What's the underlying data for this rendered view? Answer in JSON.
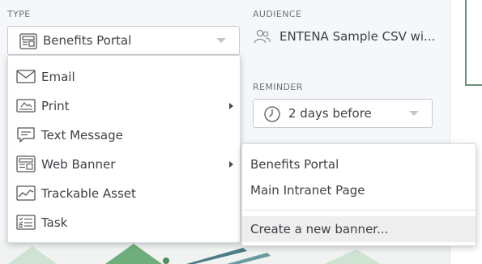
{
  "type_section": {
    "label": "TYPE",
    "selected": "Benefits Portal",
    "selected_icon": "web-banner-icon"
  },
  "audience_section": {
    "label": "AUDIENCE",
    "value": "ENTENA Sample CSV wi...",
    "icon": "people-icon"
  },
  "reminder_section": {
    "label": "REMINDER",
    "selected": "2 days before",
    "icon": "clock-icon"
  },
  "type_menu": {
    "items": [
      {
        "label": "Email",
        "icon": "email-icon",
        "has_submenu": false
      },
      {
        "label": "Print",
        "icon": "print-icon",
        "has_submenu": true
      },
      {
        "label": "Text Message",
        "icon": "text-message-icon",
        "has_submenu": false
      },
      {
        "label": "Web Banner",
        "icon": "web-banner-icon",
        "has_submenu": true
      },
      {
        "label": "Trackable Asset",
        "icon": "trackable-asset-icon",
        "has_submenu": false
      },
      {
        "label": "Task",
        "icon": "task-icon",
        "has_submenu": false
      }
    ]
  },
  "web_banner_submenu": {
    "items": [
      {
        "label": "Benefits Portal"
      },
      {
        "label": "Main Intranet Page"
      }
    ],
    "create_label": "Create a new banner..."
  },
  "colors": {
    "panel_bg": "#f5f7fa",
    "border": "#c5cbd2",
    "text": "#3d4146",
    "muted": "#6d7278",
    "art_green": "#6fae7c",
    "art_teal": "#4a7d84",
    "hover_bg": "#eeeeee"
  }
}
